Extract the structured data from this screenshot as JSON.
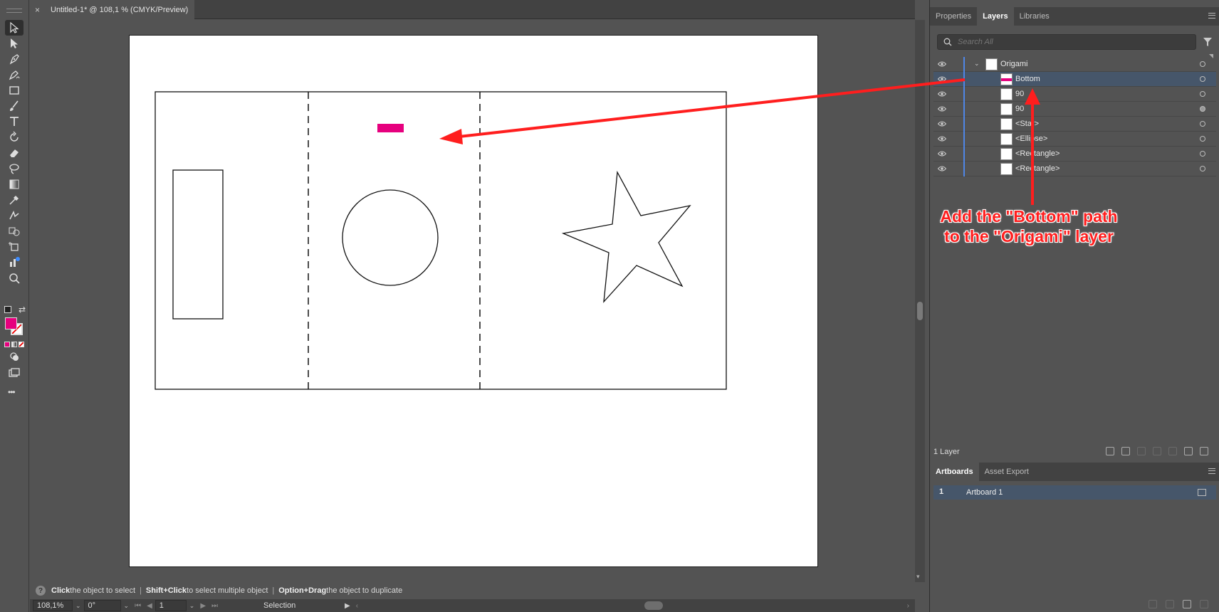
{
  "document": {
    "tab_title": "Untitled-1* @ 108,1 % (CMYK/Preview)",
    "close_glyph": "×"
  },
  "colors": {
    "fill_swatch": "#e6007e",
    "accent_selection": "#46566a",
    "layer_color_bar": "#4f86e6",
    "annotation_red": "#ff1e1e"
  },
  "toolbar": {
    "tools": [
      "selection-tool-icon",
      "direct-selection-tool-icon",
      "pen-tool-icon",
      "curvature-tool-icon",
      "rectangle-tool-icon",
      "paintbrush-tool-icon",
      "type-tool-icon",
      "rotate-tool-icon",
      "eraser-tool-icon",
      "lasso-tool-icon",
      "gradient-tool-icon",
      "eyedropper-tool-icon",
      "blend-tool-icon",
      "shape-builder-tool-icon",
      "artboard-tool-icon",
      "graph-tool-icon",
      "zoom-tool-icon"
    ],
    "more_glyph": "•••"
  },
  "hint_bar": {
    "parts": [
      {
        "key": "Click",
        "text": " the object to select"
      },
      {
        "key": "Shift+Click",
        "text": " to select multiple object"
      },
      {
        "key": "Option+Drag",
        "text": " the object to duplicate"
      }
    ],
    "separator": "|",
    "help_glyph": "?"
  },
  "status_bar": {
    "zoom": "108,1%",
    "rotation": "0°",
    "artboard_number": "1",
    "tool_name": "Selection"
  },
  "panels": {
    "top_tabs": [
      "Properties",
      "Layers",
      "Libraries"
    ],
    "active_top_tab": "Layers",
    "search_placeholder": "Search All",
    "layers": [
      {
        "name": "Origami",
        "level": 0,
        "expanded": true,
        "selected": false,
        "target_filled": false
      },
      {
        "name": "Bottom",
        "level": 1,
        "selected": true,
        "target_filled": false
      },
      {
        "name": "90",
        "level": 1,
        "selected": false,
        "target_filled": false
      },
      {
        "name": "90",
        "level": 1,
        "selected": false,
        "target_filled": true
      },
      {
        "name": "<Star>",
        "level": 1,
        "selected": false,
        "target_filled": false
      },
      {
        "name": "<Ellipse>",
        "level": 1,
        "selected": false,
        "target_filled": false
      },
      {
        "name": "<Rectangle>",
        "level": 1,
        "selected": false,
        "target_filled": false
      },
      {
        "name": "<Rectangle>",
        "level": 1,
        "selected": false,
        "target_filled": false
      }
    ],
    "layers_count": "1 Layer",
    "bottom_tabs": [
      "Artboards",
      "Asset Export"
    ],
    "active_bottom_tab": "Artboards",
    "artboards": [
      {
        "number": "1",
        "name": "Artboard 1"
      }
    ]
  },
  "annotation": {
    "line1": "Add the \"Bottom\" path",
    "line2": "to the \"Origami\" layer"
  }
}
